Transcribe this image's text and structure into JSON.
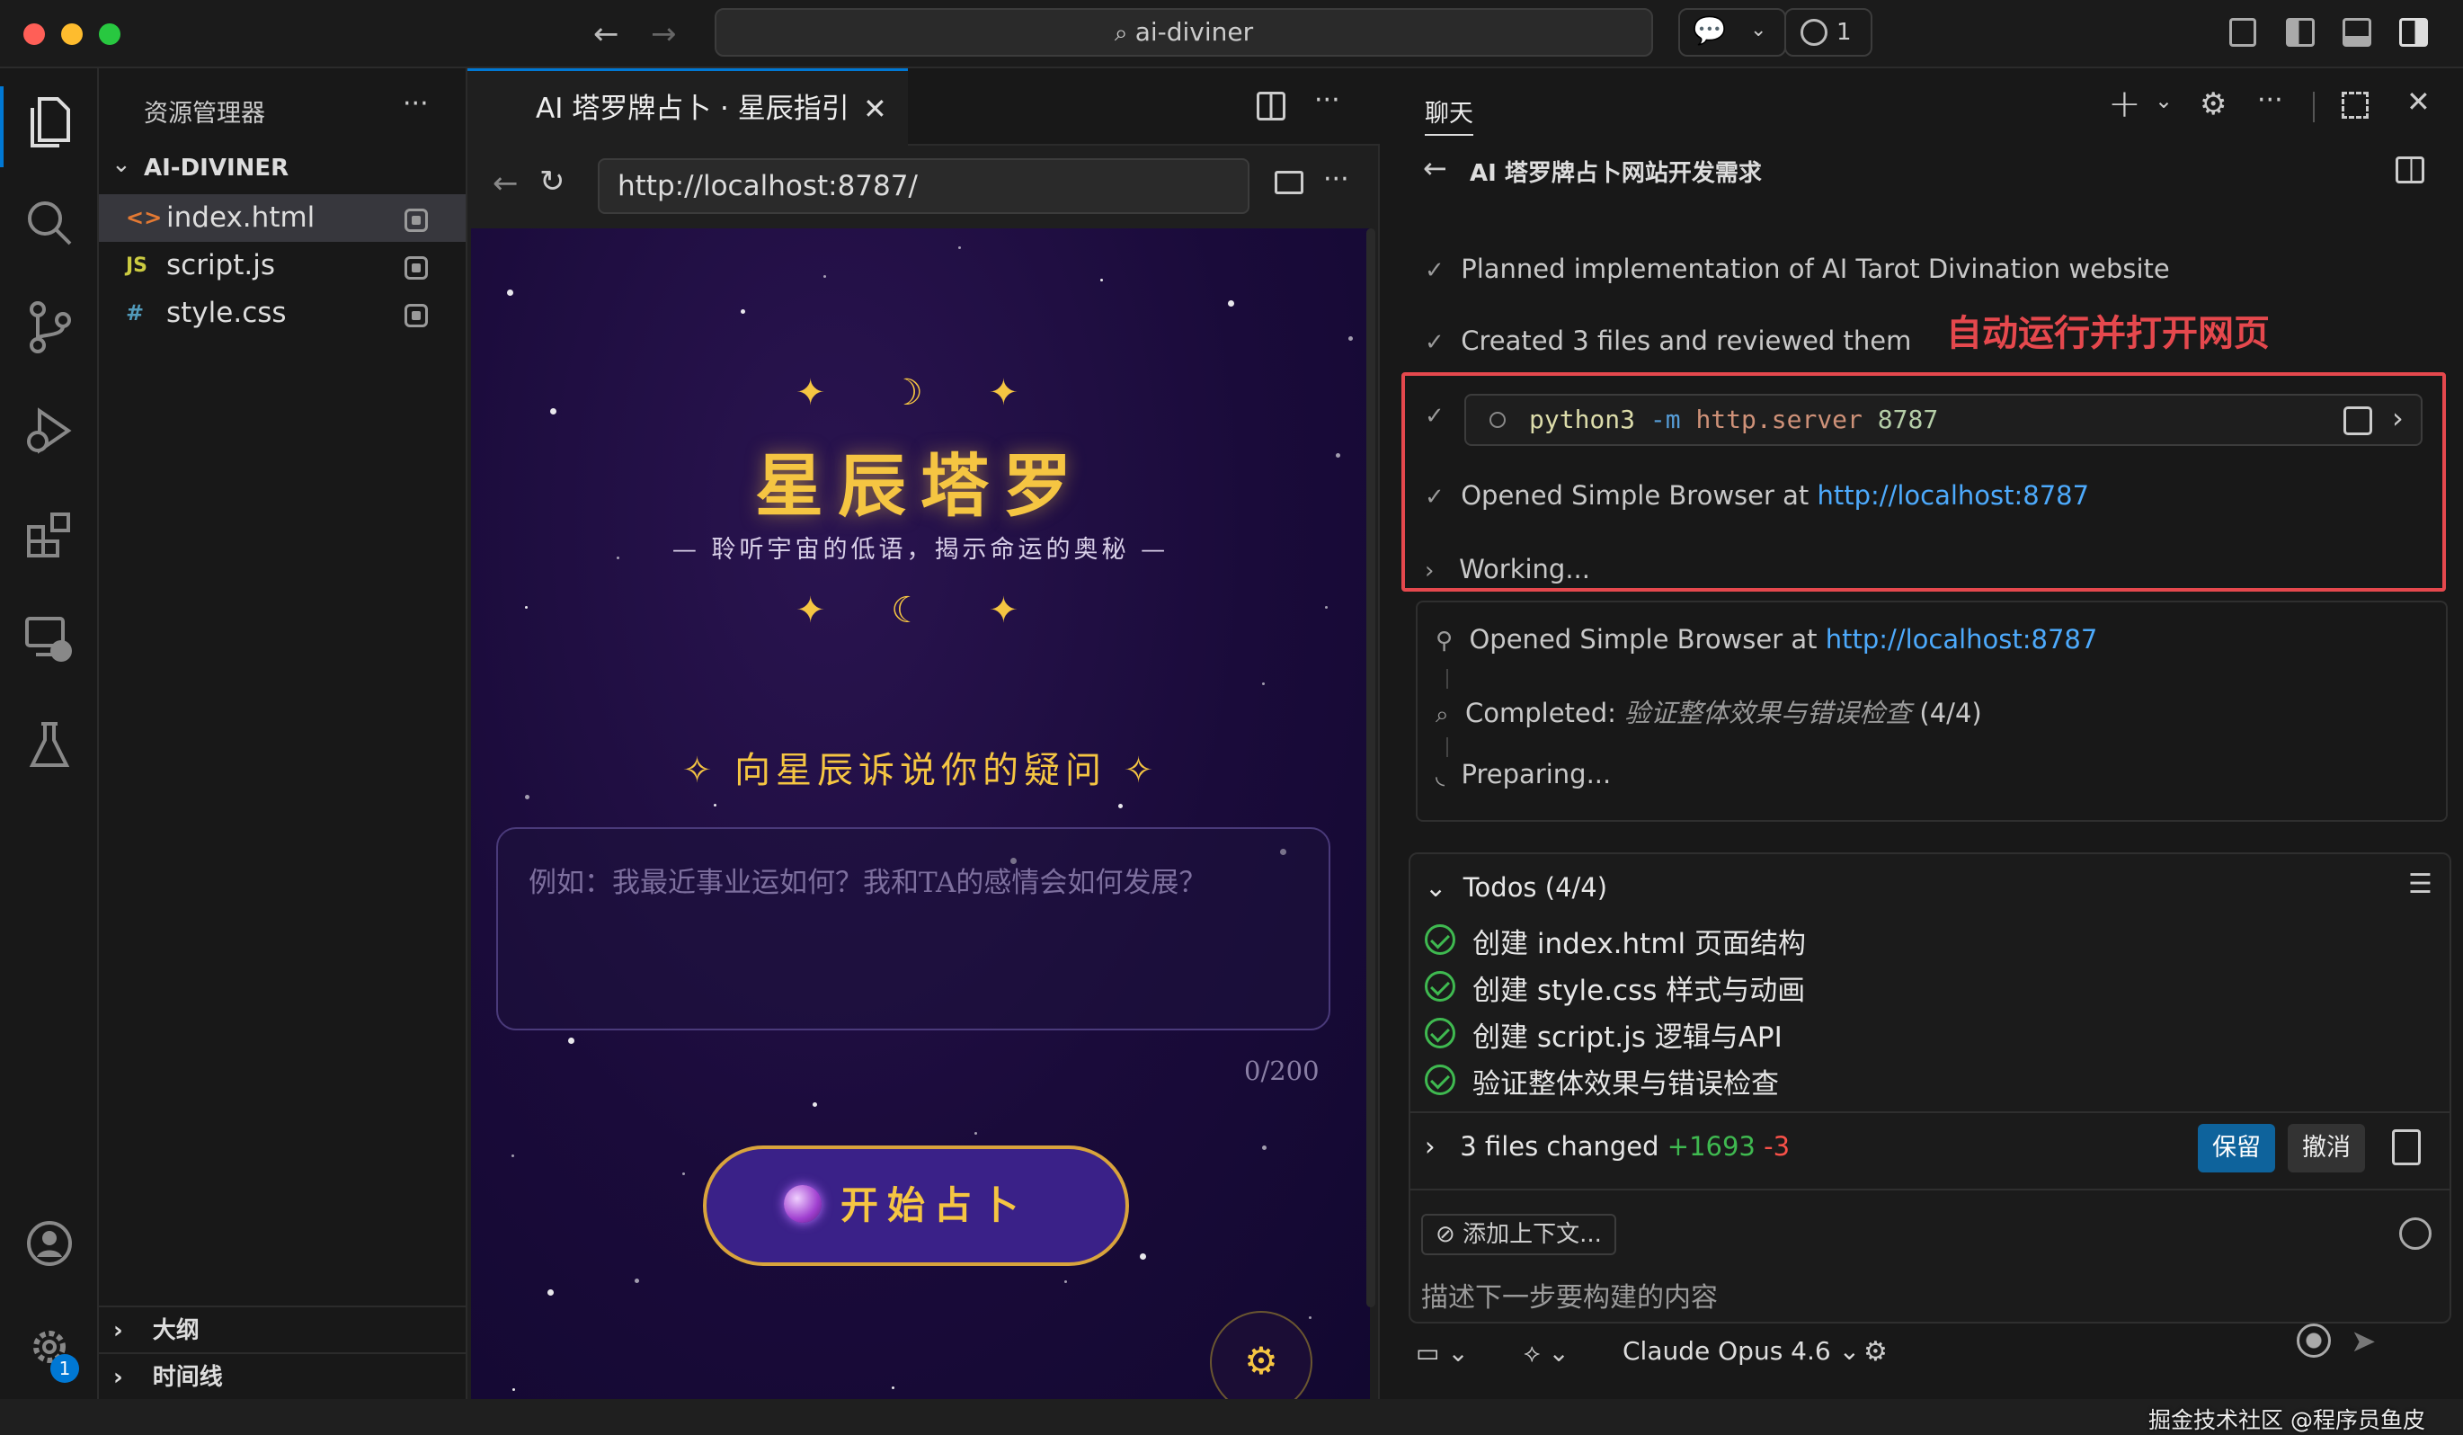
{
  "window": {
    "command_center": "ai-diviner",
    "changes_count": "1"
  },
  "explorer": {
    "title": "资源管理器",
    "folder": "AI-DIVINER",
    "files": [
      {
        "name": "index.html",
        "icon": "<>"
      },
      {
        "name": "script.js",
        "icon": "JS"
      },
      {
        "name": "style.css",
        "icon": "#"
      }
    ],
    "outline": "大纲",
    "timeline": "时间线"
  },
  "settings_badge": "1",
  "editor": {
    "tab_title": "AI 塔罗牌占卜 · 星辰指引",
    "url": "http://localhost:8787/"
  },
  "site": {
    "deco_top": "✦ ☽ ✦",
    "title": "星辰塔罗",
    "subtitle": "— 聆听宇宙的低语，揭示命运的奥秘 —",
    "deco_bottom": "✦ ☾ ✦",
    "ask_heading": "✧ 向星辰诉说你的疑问 ✧",
    "placeholder": "例如：我最近事业运如何？我和TA的感情会如何发展？",
    "counter": "0/200",
    "start_button": "开始占卜",
    "settings_icon": "⚙"
  },
  "chat": {
    "panel_title": "聊天",
    "session_title": "AI 塔罗牌占卜网站开发需求",
    "steps": [
      "Planned implementation of AI Tarot Divination website",
      "Created 3 files and reviewed them"
    ],
    "annotation": "自动运行并打开网页",
    "terminal": {
      "cmd": "python3",
      "flag": "-m",
      "module": "http.server",
      "port": "8787"
    },
    "opened_prefix": "Opened Simple Browser at ",
    "opened_link": "http://localhost:8787",
    "working": "Working...",
    "progress": {
      "opened_prefix": "Opened Simple Browser at ",
      "opened_link": "http://localhost:8787",
      "completed_prefix": "Completed: ",
      "completed_task": "验证整体效果与错误检查",
      "completed_count": " (4/4)",
      "preparing": "Preparing..."
    },
    "todos_title": "Todos (4/4)",
    "todos": [
      "创建 index.html 页面结构",
      "创建 style.css 样式与动画",
      "创建 script.js 逻辑与API",
      "验证整体效果与错误检查"
    ],
    "files_changed": "3 files changed",
    "added": "+1693",
    "removed": "-3",
    "keep": "保留",
    "undo": "撤消",
    "add_context": "添加上下文...",
    "input_placeholder": "描述下一步要构建的内容",
    "model": "Claude Opus 4.6",
    "watermark": "掘金技术社区 @程序员鱼皮"
  },
  "colors": {
    "accent": "#0078d4",
    "gold": "#f5c542",
    "annotation_red": "#e5484d",
    "link": "#4daafc"
  }
}
